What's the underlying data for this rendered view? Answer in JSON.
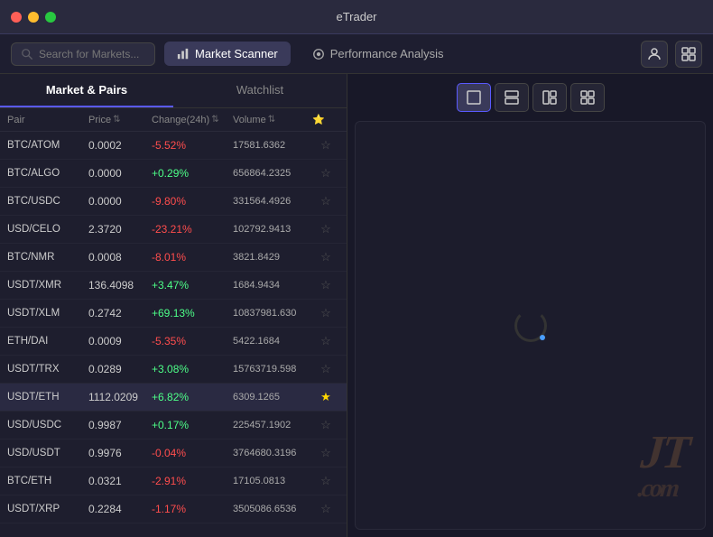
{
  "app": {
    "title": "eTrader"
  },
  "toolbar": {
    "search_placeholder": "Search for Markets...",
    "tab_market_scanner": "Market Scanner",
    "tab_performance_analysis": "Performance Analysis"
  },
  "left_panel": {
    "sub_tab_market_pairs": "Market & Pairs",
    "sub_tab_watchlist": "Watchlist",
    "table_headers": {
      "pair": "Pair",
      "price": "Price",
      "change": "Change(24h)",
      "volume": "Volume"
    },
    "rows": [
      {
        "pair": "BTC/ATOM",
        "price": "0.0002",
        "change": "-5.52%",
        "change_type": "neg",
        "volume": "17581.6362",
        "starred": false
      },
      {
        "pair": "BTC/ALGO",
        "price": "0.0000",
        "change": "+0.29%",
        "change_type": "pos",
        "volume": "656864.2325",
        "starred": false
      },
      {
        "pair": "BTC/USDC",
        "price": "0.0000",
        "change": "-9.80%",
        "change_type": "neg",
        "volume": "331564.4926",
        "starred": false
      },
      {
        "pair": "USD/CELO",
        "price": "2.3720",
        "change": "-23.21%",
        "change_type": "neg",
        "volume": "102792.9413",
        "starred": false
      },
      {
        "pair": "BTC/NMR",
        "price": "0.0008",
        "change": "-8.01%",
        "change_type": "neg",
        "volume": "3821.8429",
        "starred": false
      },
      {
        "pair": "USDT/XMR",
        "price": "136.4098",
        "change": "+3.47%",
        "change_type": "pos",
        "volume": "1684.9434",
        "starred": false
      },
      {
        "pair": "USDT/XLM",
        "price": "0.2742",
        "change": "+69.13%",
        "change_type": "pos",
        "volume": "10837981.630",
        "starred": false
      },
      {
        "pair": "ETH/DAI",
        "price": "0.0009",
        "change": "-5.35%",
        "change_type": "neg",
        "volume": "5422.1684",
        "starred": false
      },
      {
        "pair": "USDT/TRX",
        "price": "0.0289",
        "change": "+3.08%",
        "change_type": "pos",
        "volume": "15763719.598",
        "starred": false
      },
      {
        "pair": "USDT/ETH",
        "price": "1112.0209",
        "change": "+6.82%",
        "change_type": "pos",
        "volume": "6309.1265",
        "starred": true,
        "highlighted": true
      },
      {
        "pair": "USD/USDC",
        "price": "0.9987",
        "change": "+0.17%",
        "change_type": "pos",
        "volume": "225457.1902",
        "starred": false
      },
      {
        "pair": "USD/USDT",
        "price": "0.9976",
        "change": "-0.04%",
        "change_type": "neg",
        "volume": "3764680.3196",
        "starred": false
      },
      {
        "pair": "BTC/ETH",
        "price": "0.0321",
        "change": "-2.91%",
        "change_type": "neg",
        "volume": "17105.0813",
        "starred": false
      },
      {
        "pair": "USDT/XRP",
        "price": "0.2284",
        "change": "-1.17%",
        "change_type": "neg",
        "volume": "3505086.6536",
        "starred": false
      }
    ]
  },
  "chart_controls": {
    "layout1": "single",
    "layout2": "split-h",
    "layout3": "split-4",
    "layout4": "split-4b"
  },
  "icons": {
    "search": "🔍",
    "market_scanner": "📊",
    "performance_analysis": "🎯",
    "user": "👤",
    "layout": "⊞",
    "star_filled": "★",
    "star_empty": "☆"
  }
}
